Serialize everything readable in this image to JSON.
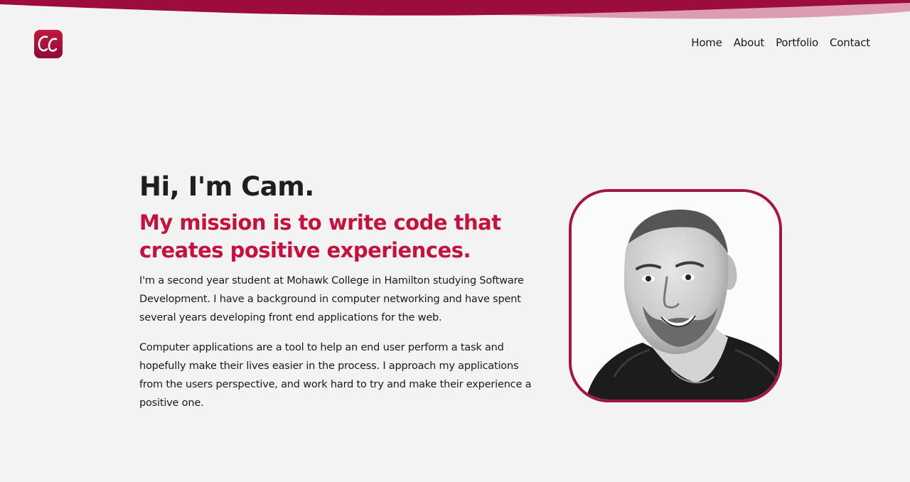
{
  "header": {
    "logo_icon": "cc-monogram-logo-icon",
    "logo_text": "CC"
  },
  "nav": {
    "items": [
      {
        "label": "Home"
      },
      {
        "label": "About"
      },
      {
        "label": "Portfolio"
      },
      {
        "label": "Contact"
      }
    ]
  },
  "hero": {
    "greeting": "Hi, I'm Cam.",
    "mission": "My mission is to write code that creates positive experiences.",
    "paragraphs": [
      "I'm a second year student at Mohawk College in Hamilton studying Software Development. I have a background in computer networking and have spent several years developing front end applications for the web.",
      "Computer applications are a tool to help an end user perform a task and hopefully make their lives easier in the process. I approach my applications from the users perspective, and work hard to try and make their experience a positive one."
    ],
    "photo_icon": "profile-photo"
  },
  "colors": {
    "background": "#f3f3f3",
    "accent": "#c2123d",
    "accent_dark": "#9c0d3e",
    "text": "#1a1a1a"
  }
}
